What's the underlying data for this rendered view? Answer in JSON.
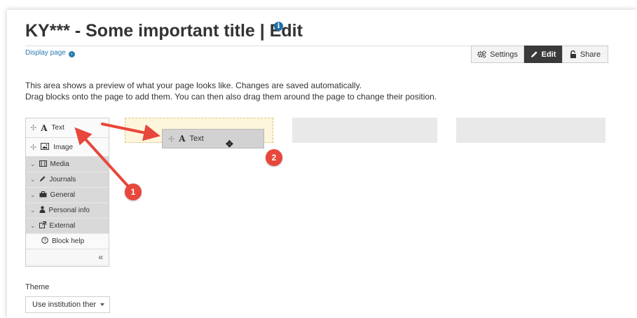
{
  "page": {
    "title": "KY*** - Some important title | Edit",
    "info_icon": "info-icon",
    "display_link": "Display page"
  },
  "toolbar": {
    "settings_label": "Settings",
    "edit_label": "Edit",
    "share_label": "Share"
  },
  "description": {
    "line1": "This area shows a preview of what your page looks like. Changes are saved automatically.",
    "line2": "Drag blocks onto the page to add them. You can then also drag them around the page to change their position."
  },
  "palette": {
    "items": [
      {
        "label": "Text",
        "icon": "text-icon"
      },
      {
        "label": "Image",
        "icon": "image-icon"
      }
    ],
    "categories": [
      {
        "label": "Media",
        "icon": "film-icon"
      },
      {
        "label": "Journals",
        "icon": "pencil-icon"
      },
      {
        "label": "General",
        "icon": "briefcase-icon"
      },
      {
        "label": "Personal info",
        "icon": "user-icon"
      },
      {
        "label": "External",
        "icon": "external-link-icon"
      }
    ],
    "help_label": "Block help",
    "collapse_label": "«"
  },
  "dragging": {
    "label": "Text"
  },
  "annotations": {
    "badge1": "1",
    "badge2": "2",
    "color": "#e8473b"
  },
  "theme": {
    "label": "Theme",
    "selected": "Use institution ther"
  },
  "colors": {
    "link": "#2a7ab0",
    "edit_button_bg": "#3a3a3a",
    "drop_zone": "#fdf6dc"
  }
}
